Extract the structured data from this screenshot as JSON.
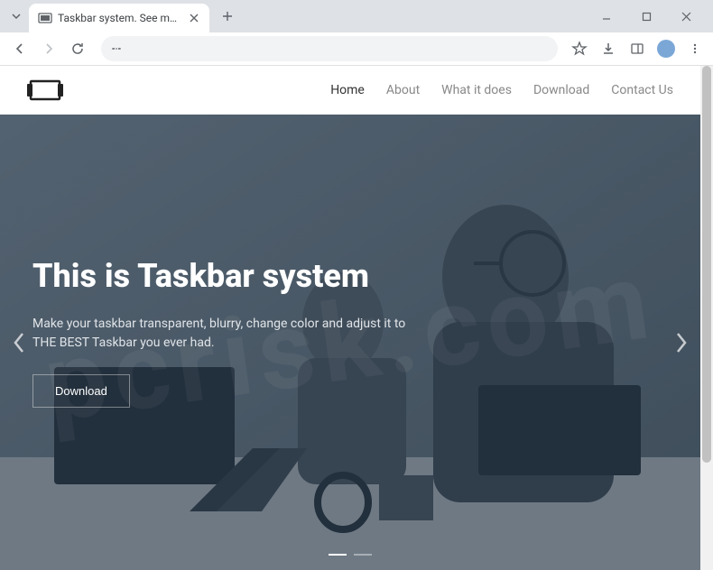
{
  "browser": {
    "tab": {
      "title": "Taskbar system. See more - do..."
    }
  },
  "site": {
    "nav": {
      "home": "Home",
      "about": "About",
      "what": "What it does",
      "download": "Download",
      "contact": "Contact Us"
    }
  },
  "hero": {
    "title": "This is Taskbar system",
    "subtitle": "Make your taskbar transparent, blurry, change color and adjust it to THE BEST Taskbar you ever had.",
    "button": "Download"
  }
}
